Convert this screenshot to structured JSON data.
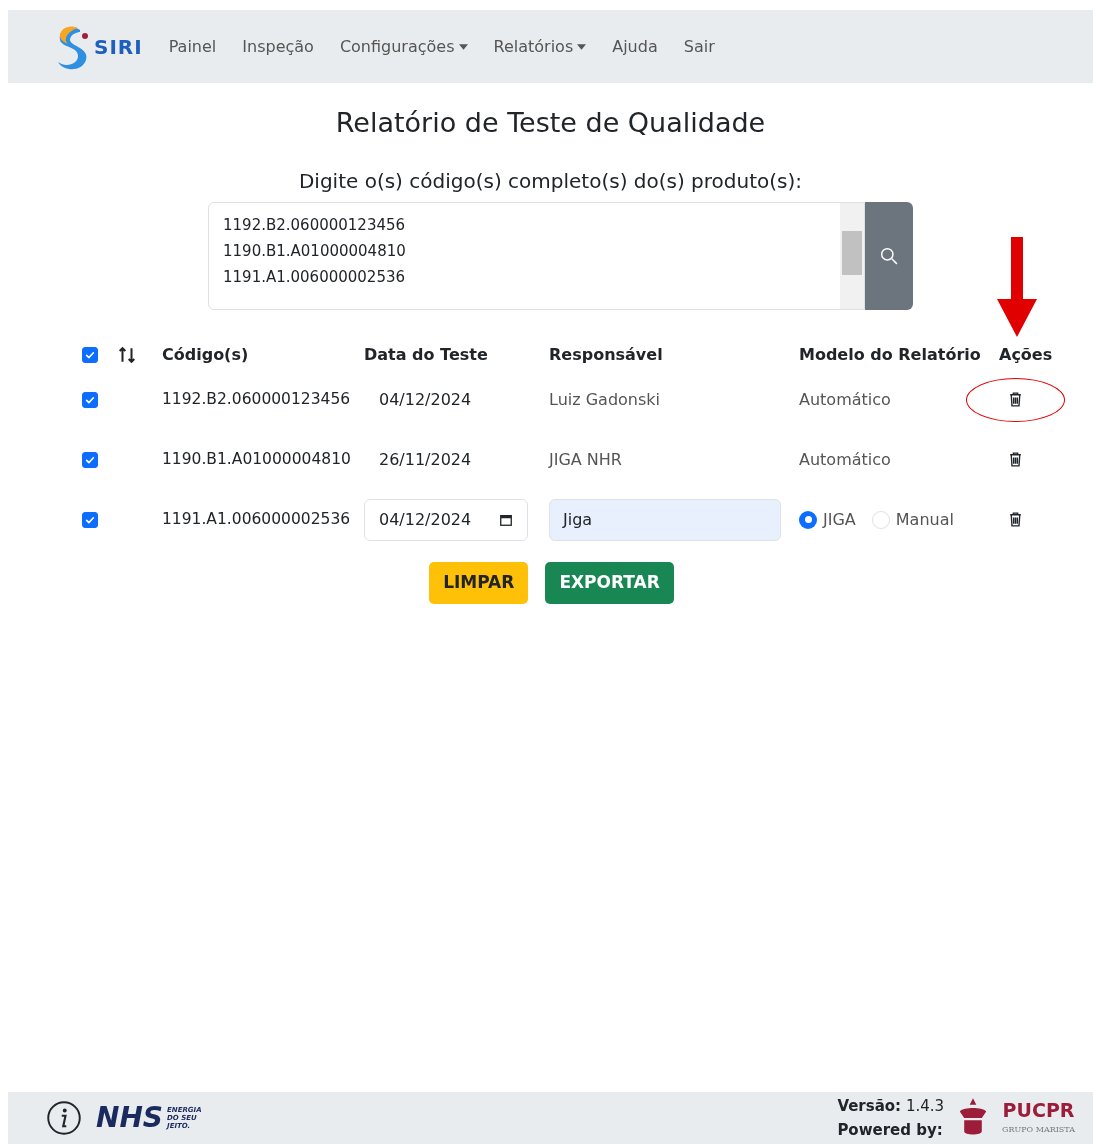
{
  "navbar": {
    "brand": "SIRI",
    "items": [
      {
        "label": "Painel",
        "dropdown": false
      },
      {
        "label": "Inspeção",
        "dropdown": false
      },
      {
        "label": "Configurações",
        "dropdown": true
      },
      {
        "label": "Relatórios",
        "dropdown": true
      },
      {
        "label": "Ajuda",
        "dropdown": false
      },
      {
        "label": "Sair",
        "dropdown": false
      }
    ]
  },
  "title": "Relatório de Teste de Qualidade",
  "codes_label": "Digite o(s) código(s) completo(s) do(s) produto(s):",
  "codes_value": "1192.B2.060000123456\n1190.B1.A01000004810\n1191.A1.006000002536",
  "table": {
    "select_all": {
      "checked": true
    },
    "columns": [
      "Código(s)",
      "Data do Teste",
      "Responsável",
      "Modelo do Relatório",
      "Ações"
    ],
    "rows": [
      {
        "kind": "text",
        "checked": true,
        "code": "1192.B2.060000123456",
        "date": "04/12/2024",
        "responsible": "Luiz Gadonski",
        "model": "Automático",
        "highlighted": true
      },
      {
        "kind": "text",
        "checked": true,
        "code": "1190.B1.A01000004810",
        "date": "26/11/2024",
        "responsible": "JIGA NHR",
        "model": "Automático",
        "highlighted": false
      },
      {
        "kind": "edit",
        "checked": true,
        "code": "1191.A1.006000002536",
        "date": "04/12/2024",
        "responsible": "Jiga",
        "model_options": [
          {
            "label": "JIGA",
            "selected": true
          },
          {
            "label": "Manual",
            "selected": false
          }
        ],
        "highlighted": false
      }
    ]
  },
  "buttons": [
    {
      "label": "LIMPAR",
      "kind": "warning"
    },
    {
      "label": "EXPORTAR",
      "kind": "success"
    }
  ],
  "footer": {
    "nhs_logo": "NHS",
    "nhs_tagline": "ENERGIA\nDO SEU\nJEITO.",
    "version_label": "Versão:",
    "version": "1.4.3",
    "powered_label": "Powered by:",
    "pucpr_logo": "PUCPR",
    "pucpr_tagline": "GRUPO MARISTA"
  }
}
